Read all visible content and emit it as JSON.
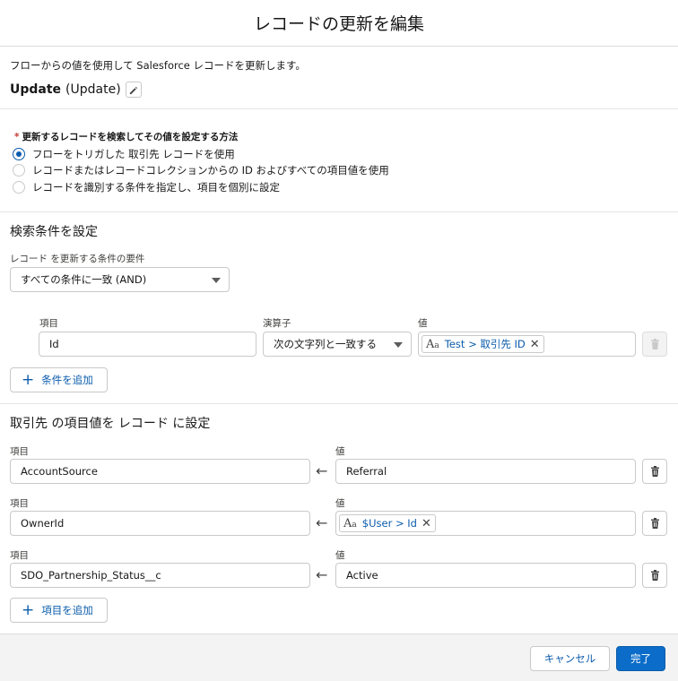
{
  "modal": {
    "title": "レコードの更新を編集"
  },
  "intro": {
    "description": "フローからの値を使用して Salesforce レコードを更新します。",
    "element_name": "Update",
    "element_api_name": "(Update)"
  },
  "how_to_find": {
    "required_marker": "*",
    "label": "更新するレコードを検索してその値を設定する方法",
    "options": [
      {
        "label": "フローをトリガした 取引先 レコードを使用",
        "selected": true
      },
      {
        "label": "レコードまたはレコードコレクションからの ID およびすべての項目値を使用",
        "selected": false
      },
      {
        "label": "レコードを識別する条件を指定し、項目を個別に設定",
        "selected": false
      }
    ]
  },
  "filter": {
    "section_title": "検索条件を設定",
    "requirement_label": "レコード を更新する条件の要件",
    "requirement_value": "すべての条件に一致 (AND)",
    "col_field": "項目",
    "col_operator": "演算子",
    "col_value": "値",
    "row": {
      "field": "Id",
      "operator": "次の文字列と一致する",
      "value_pill": "Test > 取引先 ID"
    },
    "add_condition": "条件を追加"
  },
  "assignments": {
    "section_title": "取引先 の項目値を レコード に設定",
    "field_label": "項目",
    "value_label": "値",
    "rows": [
      {
        "field": "AccountSource",
        "value": "Referral",
        "is_pill": false
      },
      {
        "field": "OwnerId",
        "value": "$User > Id",
        "is_pill": true
      },
      {
        "field": "SDO_Partnership_Status__c",
        "value": "Active",
        "is_pill": false
      }
    ],
    "add_field": "項目を追加"
  },
  "footer": {
    "cancel": "キャンセル",
    "done": "完了"
  },
  "icons": {
    "edit": "pencil-icon",
    "trash": "trash-icon",
    "arrow": "left-arrow-icon",
    "text_resource": "text-aa-icon",
    "remove": "close-icon",
    "plus": "plus-icon",
    "dropdown": "chevron-down-icon"
  },
  "colors": {
    "brand": "#0b6dc9",
    "link": "#0b5cab",
    "required": "#c23934"
  }
}
